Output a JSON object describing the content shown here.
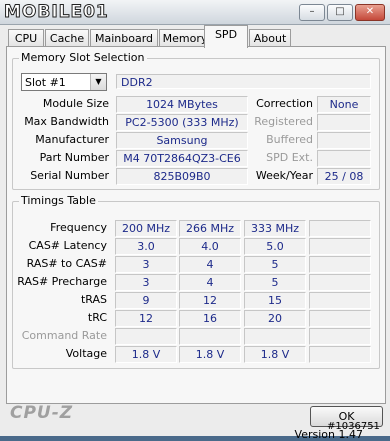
{
  "window": {
    "logo_text": "MOBILE01",
    "buttons": {
      "minimize": "–",
      "maximize": "□",
      "close": "✕"
    }
  },
  "tabs": [
    {
      "label": "CPU",
      "active": false
    },
    {
      "label": "Cache",
      "active": false
    },
    {
      "label": "Mainboard",
      "active": false
    },
    {
      "label": "Memory",
      "active": false
    },
    {
      "label": "SPD",
      "active": true
    },
    {
      "label": "About",
      "active": false
    }
  ],
  "memory_slot": {
    "group_label": "Memory Slot Selection",
    "slot_value": "Slot #1",
    "type": "DDR2",
    "rows": [
      {
        "label": "Module Size",
        "value": "1024 MBytes"
      },
      {
        "label": "Max Bandwidth",
        "value": "PC2-5300 (333 MHz)"
      },
      {
        "label": "Manufacturer",
        "value": "Samsung"
      },
      {
        "label": "Part Number",
        "value": "M4 70T2864QZ3-CE6"
      },
      {
        "label": "Serial Number",
        "value": "825B09B0"
      }
    ],
    "right_rows": [
      {
        "label": "Correction",
        "value": "None",
        "dim": false
      },
      {
        "label": "Registered",
        "value": "",
        "dim": true
      },
      {
        "label": "Buffered",
        "value": "",
        "dim": true
      },
      {
        "label": "SPD Ext.",
        "value": "",
        "dim": true
      },
      {
        "label": "Week/Year",
        "value": "25 / 08",
        "dim": false
      }
    ]
  },
  "timings": {
    "group_label": "Timings Table",
    "rows": [
      {
        "label": "Frequency",
        "values": [
          "200 MHz",
          "266 MHz",
          "333 MHz",
          ""
        ],
        "dim": false
      },
      {
        "label": "CAS# Latency",
        "values": [
          "3.0",
          "4.0",
          "5.0",
          ""
        ],
        "dim": false
      },
      {
        "label": "RAS# to CAS#",
        "values": [
          "3",
          "4",
          "5",
          ""
        ],
        "dim": false
      },
      {
        "label": "RAS# Precharge",
        "values": [
          "3",
          "4",
          "5",
          ""
        ],
        "dim": false
      },
      {
        "label": "tRAS",
        "values": [
          "9",
          "12",
          "15",
          ""
        ],
        "dim": false
      },
      {
        "label": "tRC",
        "values": [
          "12",
          "16",
          "20",
          ""
        ],
        "dim": false
      },
      {
        "label": "Command Rate",
        "values": [
          "",
          "",
          "",
          ""
        ],
        "dim": true
      },
      {
        "label": "Voltage",
        "values": [
          "1.8 V",
          "1.8 V",
          "1.8 V",
          ""
        ],
        "dim": false
      }
    ]
  },
  "footer": {
    "version": "Version 1.47",
    "brand": "CPU-Z",
    "ok_label": "OK",
    "watermark": "#1036751"
  }
}
